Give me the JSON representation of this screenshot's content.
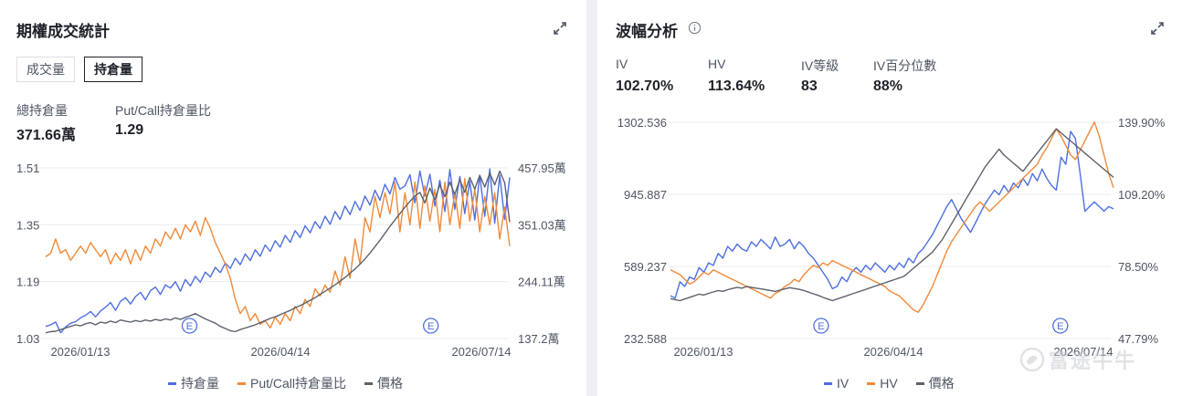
{
  "left": {
    "title": "期權成交統計",
    "tabs": [
      {
        "label": "成交量",
        "active": false
      },
      {
        "label": "持倉量",
        "active": true
      }
    ],
    "stats": [
      {
        "label": "總持倉量",
        "value": "371.66萬"
      },
      {
        "label": "Put/Call持倉量比",
        "value": "1.29"
      }
    ],
    "legend": [
      {
        "label": "持倉量",
        "color": "#4e6fe0"
      },
      {
        "label": "Put/Call持倉量比",
        "color": "#f08a3a"
      },
      {
        "label": "價格",
        "color": "#5c616b"
      }
    ]
  },
  "right": {
    "title": "波幅分析",
    "stats": [
      {
        "label": "IV",
        "value": "102.70%"
      },
      {
        "label": "HV",
        "value": "113.64%"
      },
      {
        "label": "IV等級",
        "value": "83"
      },
      {
        "label": "IV百分位數",
        "value": "88%"
      }
    ],
    "legend": [
      {
        "label": "IV",
        "color": "#4e6fe0"
      },
      {
        "label": "HV",
        "color": "#f08a3a"
      },
      {
        "label": "價格",
        "color": "#5c616b"
      }
    ]
  },
  "watermark": {
    "text": "富途牛牛"
  },
  "chart_data": [
    {
      "type": "line",
      "x_labels": [
        "2026/01/13",
        "2026/04/14",
        "2026/07/14"
      ],
      "y_left_ticks": [
        "1.51",
        "1.35",
        "1.19",
        "1.03"
      ],
      "y_left_range": [
        1.03,
        1.51
      ],
      "y_right_ticks": [
        "457.95萬",
        "351.03萬",
        "244.11萬",
        "137.2萬"
      ],
      "y_right_range": [
        137.2,
        457.95
      ],
      "event_markers": [
        {
          "label": "E",
          "t": 0.31
        },
        {
          "label": "E",
          "t": 0.83
        }
      ],
      "series": [
        {
          "name": "持倉量",
          "axis": "right",
          "color": "#4e6fe0",
          "values": [
            160,
            163,
            168,
            148,
            159,
            166,
            169,
            176,
            181,
            188,
            178,
            189,
            196,
            205,
            190,
            207,
            214,
            202,
            216,
            224,
            210,
            227,
            234,
            220,
            238,
            232,
            244,
            226,
            248,
            236,
            254,
            243,
            262,
            253,
            271,
            261,
            279,
            269,
            288,
            276,
            296,
            284,
            304,
            292,
            313,
            301,
            321,
            309,
            331,
            318,
            340,
            327,
            349,
            336,
            357,
            344,
            367,
            352,
            376,
            361,
            386,
            370,
            395,
            378,
            405,
            388,
            416,
            397,
            427,
            409,
            440,
            418,
            424,
            445,
            392,
            452,
            405,
            446,
            386,
            435,
            376,
            455,
            380,
            442,
            372,
            433,
            360,
            444,
            367,
            456,
            354,
            444,
            361,
            440
          ]
        },
        {
          "name": "Put/Call持倉量比",
          "axis": "left",
          "color": "#f08a3a",
          "values": [
            1.26,
            1.27,
            1.31,
            1.27,
            1.28,
            1.25,
            1.27,
            1.29,
            1.27,
            1.3,
            1.28,
            1.26,
            1.28,
            1.24,
            1.27,
            1.25,
            1.28,
            1.24,
            1.28,
            1.25,
            1.29,
            1.27,
            1.31,
            1.29,
            1.33,
            1.31,
            1.34,
            1.31,
            1.35,
            1.33,
            1.36,
            1.32,
            1.37,
            1.34,
            1.3,
            1.27,
            1.24,
            1.2,
            1.14,
            1.1,
            1.12,
            1.08,
            1.1,
            1.07,
            1.08,
            1.06,
            1.09,
            1.07,
            1.1,
            1.08,
            1.12,
            1.1,
            1.14,
            1.12,
            1.17,
            1.15,
            1.18,
            1.16,
            1.22,
            1.18,
            1.26,
            1.2,
            1.31,
            1.24,
            1.37,
            1.33,
            1.43,
            1.37,
            1.44,
            1.38,
            1.47,
            1.33,
            1.44,
            1.35,
            1.47,
            1.34,
            1.46,
            1.36,
            1.45,
            1.33,
            1.47,
            1.35,
            1.44,
            1.34,
            1.48,
            1.36,
            1.45,
            1.33,
            1.43,
            1.35,
            1.44,
            1.31,
            1.4,
            1.29
          ]
        },
        {
          "name": "價格",
          "axis": "right",
          "color": "#5c616b",
          "values": [
            148,
            150,
            151,
            154,
            157,
            160,
            163,
            161,
            165,
            167,
            163,
            168,
            166,
            170,
            167,
            172,
            170,
            168,
            171,
            169,
            172,
            170,
            173,
            171,
            174,
            172,
            176,
            173,
            177,
            180,
            184,
            179,
            174,
            170,
            166,
            160,
            156,
            152,
            150,
            154,
            157,
            160,
            163,
            167,
            171,
            175,
            178,
            182,
            186,
            190,
            195,
            199,
            204,
            209,
            214,
            220,
            226,
            232,
            238,
            245,
            252,
            260,
            268,
            277,
            287,
            298,
            310,
            322,
            335,
            348,
            360,
            372,
            384,
            395,
            405,
            412,
            392,
            420,
            398,
            426,
            404,
            431,
            408,
            436,
            412,
            440,
            418,
            444,
            422,
            448,
            426,
            452,
            430,
            356
          ]
        }
      ]
    },
    {
      "type": "line",
      "x_labels": [
        "2026/01/13",
        "2026/04/14",
        "2026/07/14"
      ],
      "y_left_ticks": [
        "1302.536",
        "945.887",
        "589.237",
        "232.588"
      ],
      "y_left_range": [
        232.588,
        1302.536
      ],
      "y_right_ticks": [
        "139.90%",
        "109.20%",
        "78.50%",
        "47.79%"
      ],
      "y_right_range": [
        47.79,
        139.9
      ],
      "event_markers": [
        {
          "label": "E",
          "t": 0.34
        },
        {
          "label": "E",
          "t": 0.88
        }
      ],
      "series": [
        {
          "name": "IV",
          "axis": "right",
          "color": "#4e6fe0",
          "values": [
            66,
            65,
            72,
            70,
            74,
            73,
            78,
            76,
            80,
            79,
            84,
            82,
            87,
            85,
            88,
            86,
            85,
            89,
            87,
            90,
            88,
            86,
            91,
            87,
            88,
            90,
            86,
            89,
            87,
            84,
            82,
            79,
            76,
            73,
            69,
            70,
            74,
            72,
            76,
            78,
            76,
            79,
            77,
            80,
            78,
            76,
            79,
            77,
            80,
            78,
            82,
            80,
            84,
            86,
            89,
            92,
            96,
            100,
            104,
            107,
            103,
            99,
            96,
            93,
            97,
            101,
            105,
            108,
            111,
            109,
            113,
            110,
            114,
            112,
            116,
            113,
            118,
            115,
            120,
            116,
            113,
            111,
            125,
            122,
            136,
            133,
            118,
            102,
            104,
            106,
            104,
            102,
            104,
            103
          ]
        },
        {
          "name": "HV",
          "axis": "right",
          "color": "#f08a3a",
          "values": [
            77,
            76,
            75,
            73,
            71,
            72,
            74,
            76,
            75,
            77,
            76,
            75,
            74,
            73,
            72,
            71,
            70,
            69,
            68,
            67,
            66,
            65,
            67,
            68,
            70,
            71,
            73,
            72,
            75,
            77,
            79,
            78,
            80,
            79,
            81,
            80,
            79,
            78,
            77,
            76,
            75,
            74,
            73,
            72,
            71,
            70,
            68,
            67,
            66,
            64,
            62,
            60,
            59,
            62,
            66,
            70,
            75,
            80,
            85,
            89,
            92,
            95,
            98,
            101,
            104,
            106,
            104,
            102,
            104,
            106,
            108,
            110,
            112,
            114,
            116,
            118,
            120,
            122,
            126,
            129,
            133,
            137,
            134,
            130,
            126,
            124,
            128,
            132,
            136,
            140,
            134,
            126,
            118,
            112
          ]
        },
        {
          "name": "價格",
          "axis": "left",
          "color": "#5c616b",
          "values": [
            430,
            425,
            420,
            428,
            436,
            444,
            452,
            448,
            456,
            463,
            470,
            466,
            474,
            480,
            486,
            482,
            490,
            486,
            482,
            478,
            474,
            470,
            466,
            472,
            478,
            484,
            480,
            476,
            470,
            462,
            454,
            446,
            436,
            428,
            420,
            428,
            436,
            444,
            452,
            460,
            468,
            476,
            484,
            492,
            500,
            508,
            516,
            524,
            532,
            540,
            560,
            580,
            600,
            620,
            640,
            660,
            690,
            720,
            760,
            800,
            840,
            880,
            920,
            960,
            1000,
            1040,
            1080,
            1110,
            1140,
            1170,
            1140,
            1120,
            1100,
            1080,
            1060,
            1090,
            1120,
            1150,
            1180,
            1210,
            1240,
            1270,
            1250,
            1230,
            1210,
            1190,
            1170,
            1150,
            1130,
            1110,
            1090,
            1070,
            1050,
            1030
          ]
        }
      ]
    }
  ]
}
